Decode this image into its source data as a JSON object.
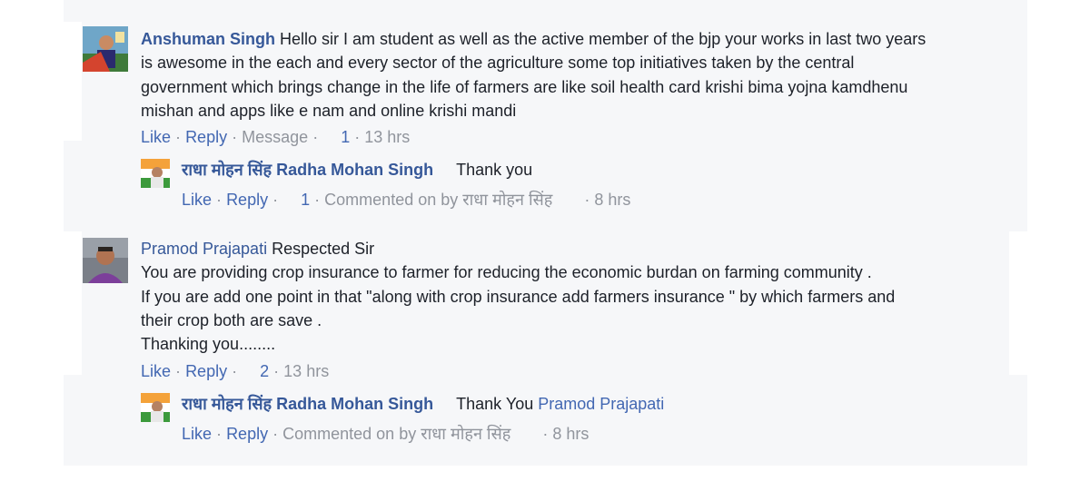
{
  "comments": [
    {
      "author": "Anshuman Singh",
      "lines": [
        "Hello sir I am student as well as the active member of the bjp your works in last two years",
        "is awesome in the each and every sector of the agriculture some top initiatives taken by the central",
        "government which brings change in the life of farmers are like soil health card krishi bima yojna kamdhenu",
        "mishan and apps like e nam and online krishi mandi"
      ],
      "actions": {
        "like": "Like",
        "reply": "Reply",
        "message": "Message",
        "like_count": "1",
        "time": "13 hrs"
      },
      "reply": {
        "author": "राधा मोहन सिंह Radha Mohan Singh",
        "text": "Thank you",
        "actions": {
          "like": "Like",
          "reply": "Reply",
          "like_count": "1",
          "commented_on": "Commented on by राधा मोहन सिंह",
          "time": "8 hrs"
        }
      }
    },
    {
      "author": "Pramod Prajapati",
      "first_line": "Respected Sir",
      "lines": [
        "You are providing crop insurance to farmer for reducing the economic burdan on farming community .",
        "If you are add one point in that \"along with crop insurance add farmers insurance \" by which farmers and",
        "their crop both are save .",
        "Thanking you........"
      ],
      "actions": {
        "like": "Like",
        "reply": "Reply",
        "like_count": "2",
        "time": "13 hrs"
      },
      "reply": {
        "author": "राधा मोहन सिंह Radha Mohan Singh",
        "text": "Thank You",
        "mention": "Pramod Prajapati",
        "actions": {
          "like": "Like",
          "reply": "Reply",
          "commented_on": "Commented on by राधा मोहन सिंह",
          "time": "8 hrs"
        }
      }
    }
  ],
  "separator": "·"
}
